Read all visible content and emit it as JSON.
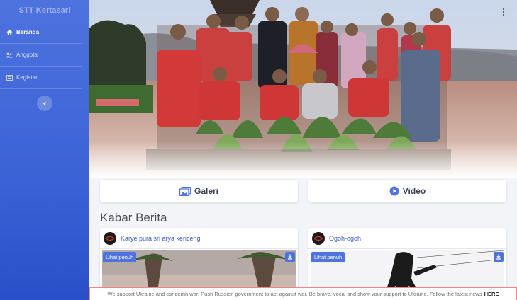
{
  "sidebar": {
    "brand": "STT Kertasari",
    "items": [
      {
        "label": "Beranda",
        "icon": "home-icon",
        "active": true
      },
      {
        "label": "Anggota",
        "icon": "users-icon",
        "active": false
      },
      {
        "label": "Kegiatan",
        "icon": "book-icon",
        "active": false
      }
    ],
    "toggle_icon": "chevron-left-icon"
  },
  "actions": {
    "galeri": "Galeri",
    "video": "Video"
  },
  "news": {
    "heading": "Kabar Berita",
    "cards": [
      {
        "title": "Karye pura sri arya kenceng",
        "badge": "Lihat penuh"
      },
      {
        "title": "Ogoh-ogoh",
        "badge": "Lihat penuh"
      }
    ]
  },
  "banner": {
    "text": "We support Ukraine and condemn war. Push Russian government to act against war. Be brave, vocal and show your support to Ukraine. Follow the latest news",
    "link": "HERE"
  },
  "colors": {
    "primary": "#4e73df",
    "sidebar_bottom": "#2a50c9"
  }
}
